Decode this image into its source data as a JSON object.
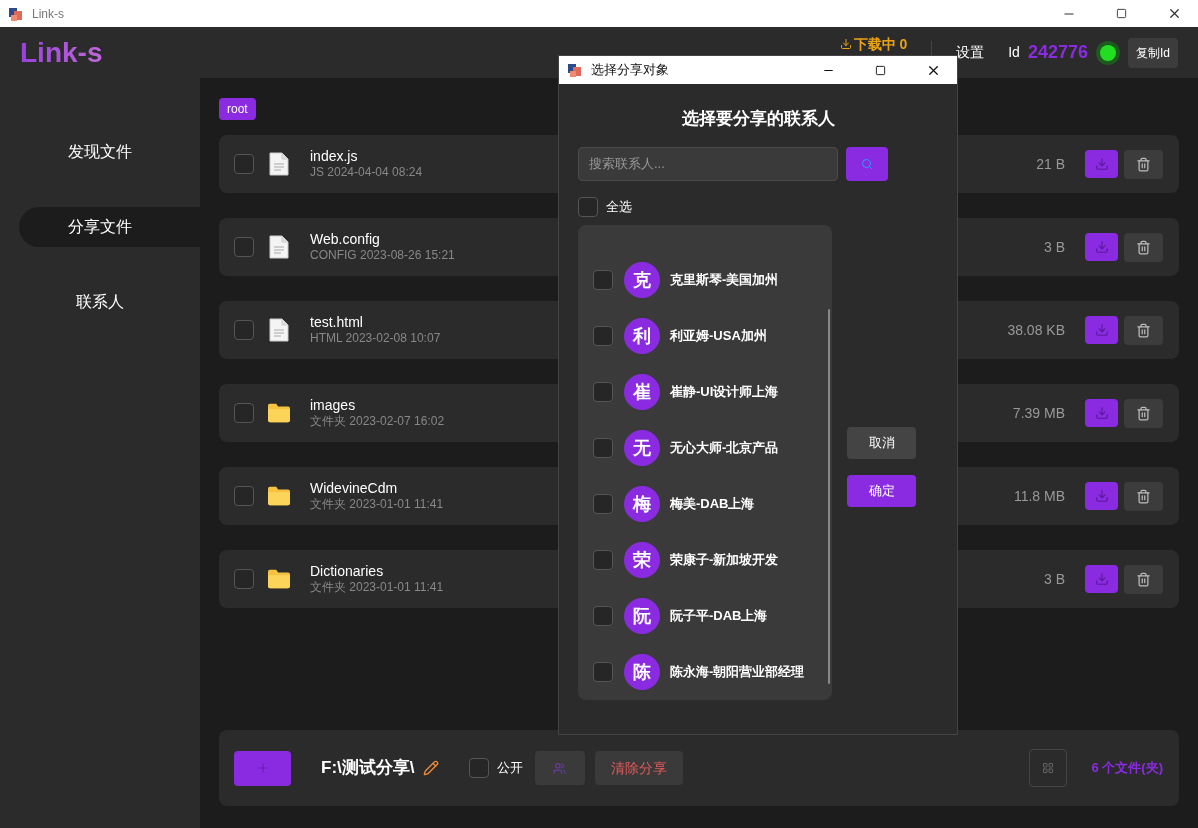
{
  "window": {
    "title": "Link-s"
  },
  "header": {
    "logo": "Link-s",
    "downloading": "下载中 0",
    "settings": "设置",
    "id_label": "Id",
    "id_value": "242776",
    "online": true,
    "copy_button": "复制Id"
  },
  "sidebar": {
    "items": [
      {
        "label": "发现文件",
        "selected": false
      },
      {
        "label": "分享文件",
        "selected": true
      },
      {
        "label": "联系人",
        "selected": false
      }
    ]
  },
  "breadcrumb": "root",
  "files": [
    {
      "kind": "file",
      "name": "index.js",
      "meta": "JS 2024-04-04 08:24",
      "size": "21 B",
      "checked": false
    },
    {
      "kind": "file",
      "name": "Web.config",
      "meta": "CONFIG 2023-08-26 15:21",
      "size": "3 B",
      "checked": false
    },
    {
      "kind": "file",
      "name": "test.html",
      "meta": "HTML 2023-02-08 10:07",
      "size": "38.08 KB",
      "checked": false
    },
    {
      "kind": "folder",
      "name": "images",
      "meta": "文件夹 2023-02-07 16:02",
      "size": "7.39 MB",
      "checked": false
    },
    {
      "kind": "folder",
      "name": "WidevineCdm",
      "meta": "文件夹 2023-01-01 11:41",
      "size": "11.8 MB",
      "checked": false
    },
    {
      "kind": "folder",
      "name": "Dictionaries",
      "meta": "文件夹 2023-01-01 11:41",
      "size": "3 B",
      "checked": false
    }
  ],
  "bottom_bar": {
    "path": "F:\\测试分享\\",
    "public_label": "公开",
    "public_checked": false,
    "clear_button": "清除分享",
    "file_count": "6 个文件(夹)"
  },
  "dialog": {
    "title": "选择分享对象",
    "heading": "选择要分享的联系人",
    "search": {
      "placeholder": "搜索联系人..."
    },
    "select_all": {
      "label": "全选",
      "checked": false
    },
    "contacts": [
      {
        "initial": "克",
        "name": "克里斯琴-美国加州",
        "checked": false
      },
      {
        "initial": "利",
        "name": "利亚姆-USA加州",
        "checked": false
      },
      {
        "initial": "崔",
        "name": "崔静-UI设计师上海",
        "checked": false
      },
      {
        "initial": "无",
        "name": "无心大师-北京产品",
        "checked": false
      },
      {
        "initial": "梅",
        "name": "梅美-DAB上海",
        "checked": false
      },
      {
        "initial": "荣",
        "name": "荣康子-新加坡开发",
        "checked": false
      },
      {
        "initial": "阮",
        "name": "阮子平-DAB上海",
        "checked": false
      },
      {
        "initial": "陈",
        "name": "陈永海-朝阳营业部经理",
        "checked": false
      }
    ],
    "cancel_button": "取消",
    "confirm_button": "确定"
  }
}
